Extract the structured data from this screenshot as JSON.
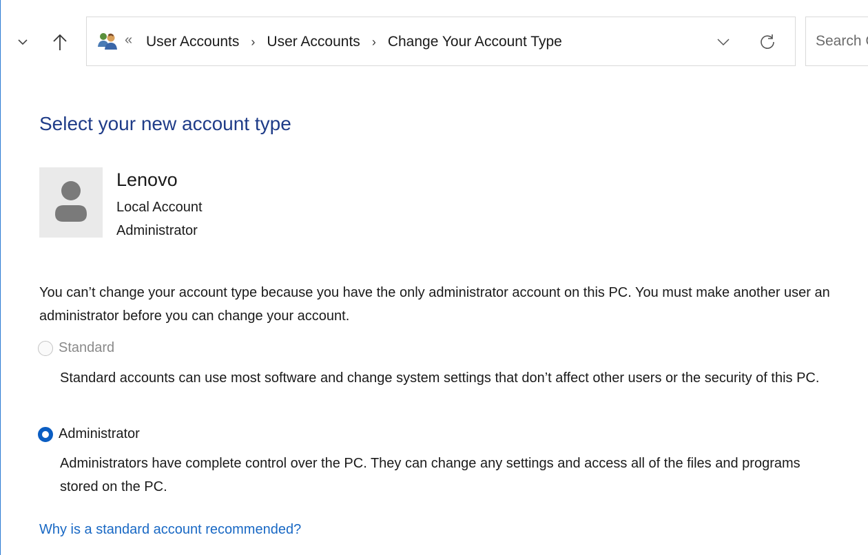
{
  "navigation": {
    "recent_locations_icon": "chevron-down-icon",
    "up_icon": "arrow-up-icon"
  },
  "address_bar": {
    "location_icon": "user-accounts-icon",
    "overflow": "«",
    "breadcrumbs": [
      {
        "label": "User Accounts"
      },
      {
        "label": "User Accounts"
      },
      {
        "label": "Change Your Account Type"
      }
    ],
    "separator": "›",
    "dropdown_icon": "chevron-down-icon",
    "refresh_icon": "refresh-icon"
  },
  "search": {
    "placeholder": "Search Control Panel"
  },
  "page": {
    "title": "Select your new account type",
    "user": {
      "avatar_icon": "user-avatar-icon",
      "name": "Lenovo",
      "account_type": "Local Account",
      "role": "Administrator"
    },
    "notice": "You can’t change your account type because you have the only administrator account on this PC. You must make another user an administrator before you can change your account.",
    "options": [
      {
        "label": "Standard",
        "description": "Standard accounts can use most software and change system settings that don’t affect other users or the security of this PC.",
        "selected": false,
        "disabled": true
      },
      {
        "label": "Administrator",
        "description": "Administrators have complete control over the PC. They can change any settings and access all of the files and programs stored on the PC.",
        "selected": true,
        "disabled": false
      }
    ],
    "help_link": "Why is a standard account recommended?"
  },
  "colors": {
    "title": "#1f3c88",
    "link": "#1868c4",
    "radio_selected": "#0a5dc2",
    "window_border": "#2b7bd3"
  }
}
